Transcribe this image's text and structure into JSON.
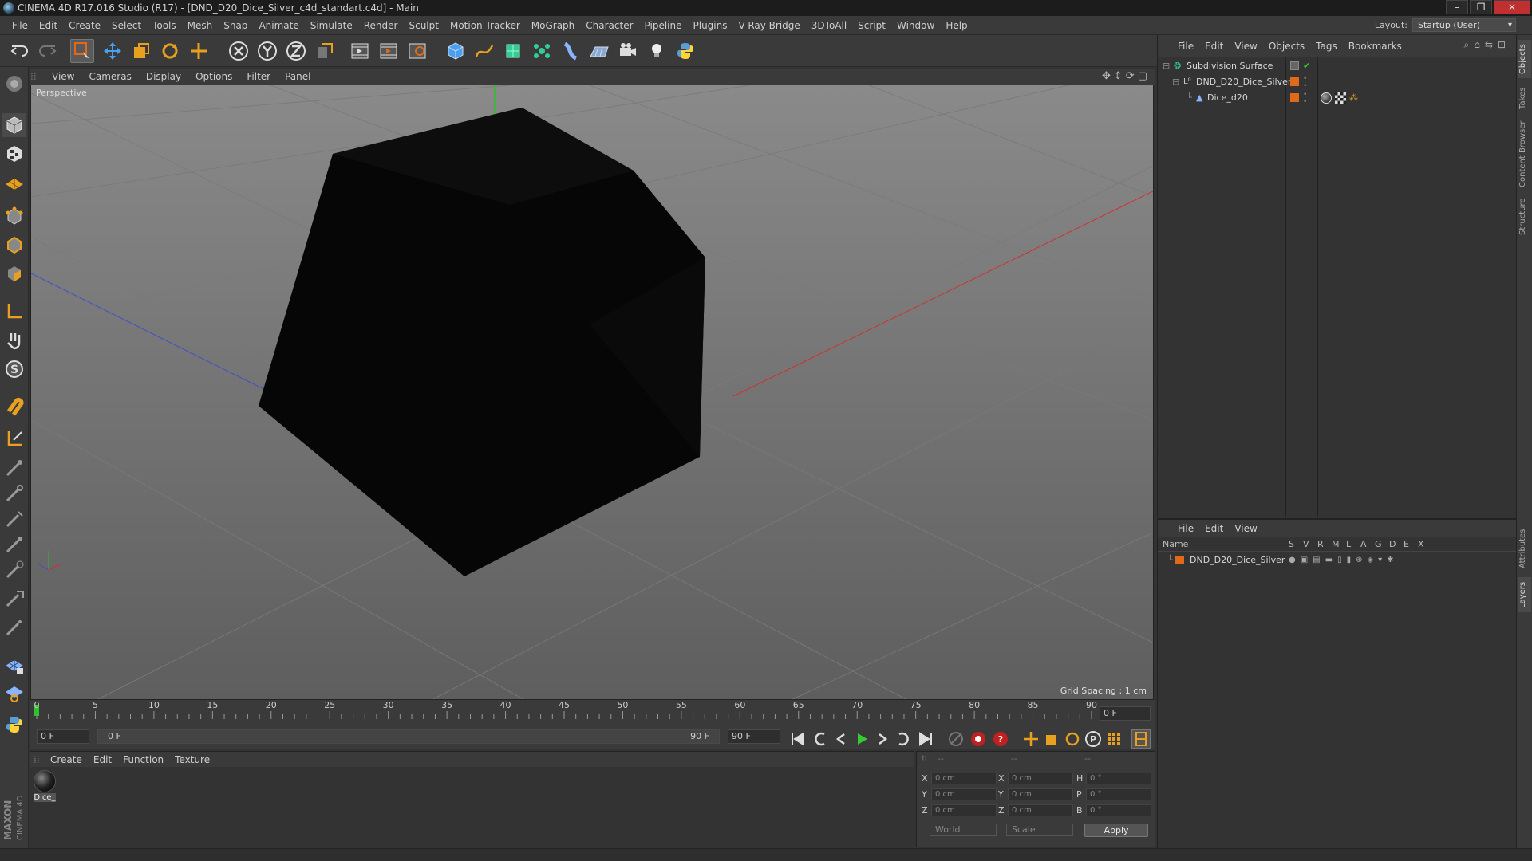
{
  "window": {
    "title": "CINEMA 4D R17.016 Studio (R17) - [DND_D20_Dice_Silver_c4d_standart.c4d] - Main",
    "controls": [
      "–",
      "❐",
      "✕"
    ]
  },
  "menubar": {
    "items": [
      "File",
      "Edit",
      "Create",
      "Select",
      "Tools",
      "Mesh",
      "Snap",
      "Animate",
      "Simulate",
      "Render",
      "Sculpt",
      "Motion Tracker",
      "MoGraph",
      "Character",
      "Pipeline",
      "Plugins",
      "V-Ray Bridge",
      "3DToAll",
      "Script",
      "Window",
      "Help"
    ],
    "layout_label": "Layout:",
    "layout_value": "Startup (User)"
  },
  "toolbar": {
    "icons": [
      "undo-icon",
      "redo-icon",
      "live-selection-icon",
      "move-icon",
      "scale-icon",
      "rotate-icon",
      "last-tool-icon",
      "x-axis-icon",
      "y-axis-icon",
      "z-axis-icon",
      "coordinate-system-icon",
      "render-view-icon",
      "render-picture-viewer-icon",
      "render-settings-icon",
      "cube-primitive-icon",
      "spline-pen-icon",
      "subdivision-icon",
      "mograph-cloner-icon",
      "deformer-icon",
      "floor-icon",
      "camera-icon",
      "light-icon",
      "python-icon"
    ]
  },
  "viewport": {
    "menu": [
      "View",
      "Cameras",
      "Display",
      "Options",
      "Filter",
      "Panel"
    ],
    "camera_label": "Perspective",
    "grid_spacing": "Grid Spacing : 1 cm"
  },
  "timeline": {
    "ticks": [
      "0",
      "5",
      "10",
      "15",
      "20",
      "25",
      "30",
      "35",
      "40",
      "45",
      "50",
      "55",
      "60",
      "65",
      "70",
      "75",
      "80",
      "85",
      "90"
    ],
    "current_frame": "0 F",
    "start_field": "0 F",
    "range_start": "0 F",
    "range_end": "90 F",
    "end_field": "90 F"
  },
  "material_manager": {
    "menu": [
      "Create",
      "Edit",
      "Function",
      "Texture"
    ],
    "materials": [
      {
        "name": "Dice_"
      }
    ]
  },
  "coordinates": {
    "headers": [
      "--",
      "--",
      "--"
    ],
    "rows": [
      {
        "a": "X",
        "av": "0 cm",
        "b": "X",
        "bv": "0 cm",
        "c": "H",
        "cv": "0 °"
      },
      {
        "a": "Y",
        "av": "0 cm",
        "b": "Y",
        "bv": "0 cm",
        "c": "P",
        "cv": "0 °"
      },
      {
        "a": "Z",
        "av": "0 cm",
        "b": "Z",
        "bv": "0 cm",
        "c": "B",
        "cv": "0 °"
      }
    ],
    "mode": "World",
    "transform": "Scale",
    "apply_label": "Apply"
  },
  "object_manager": {
    "menu": [
      "File",
      "Edit",
      "View",
      "Objects",
      "Tags",
      "Bookmarks"
    ],
    "objects": [
      {
        "name": "Subdivision Surface",
        "indent": 0
      },
      {
        "name": "DND_D20_Dice_Silver",
        "indent": 1
      },
      {
        "name": "Dice_d20",
        "indent": 2
      }
    ]
  },
  "layer_manager": {
    "menu": [
      "File",
      "Edit",
      "View"
    ],
    "columns": [
      "Name",
      "S",
      "V",
      "R",
      "M",
      "L",
      "A",
      "G",
      "D",
      "E",
      "X"
    ],
    "layers": [
      {
        "name": "DND_D20_Dice_Silver",
        "color": "#e06a1a"
      }
    ]
  },
  "right_tabs": [
    "Objects",
    "Takes",
    "Content Browser",
    "Structure",
    "Attributes",
    "Layers"
  ],
  "branding": {
    "company": "MAXON",
    "product": "CINEMA 4D"
  },
  "colors": {
    "accent_orange": "#e8a020",
    "axis_x": "#c83030",
    "axis_y": "#30b030",
    "axis_z": "#3048c8",
    "layer_orange": "#e06a1a"
  }
}
